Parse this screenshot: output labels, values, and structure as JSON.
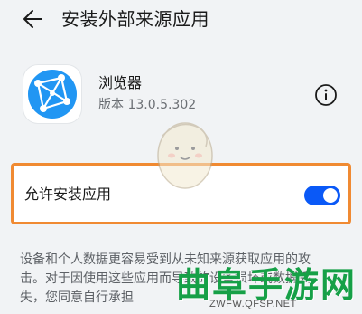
{
  "header": {
    "back_icon": "arrow-left-icon",
    "title": "安装外部来源应用"
  },
  "app": {
    "name": "浏览器",
    "version": "版本 13.0.5.302",
    "icon": "browser-globe-icon",
    "info_icon": "info-icon"
  },
  "permission": {
    "label": "允许安装应用",
    "enabled": true,
    "accent": "#0a59f7",
    "highlight": "#f08a32"
  },
  "description": "设备和个人数据更容易受到从未知来源获取应用的攻击。对于因使用这些应用而导致的设备损坏或数据丢失，您同意自行承担",
  "watermark": {
    "text": "曲阜手游网",
    "url": "ZWFW.QFSP.NET",
    "color": "#16a047"
  }
}
